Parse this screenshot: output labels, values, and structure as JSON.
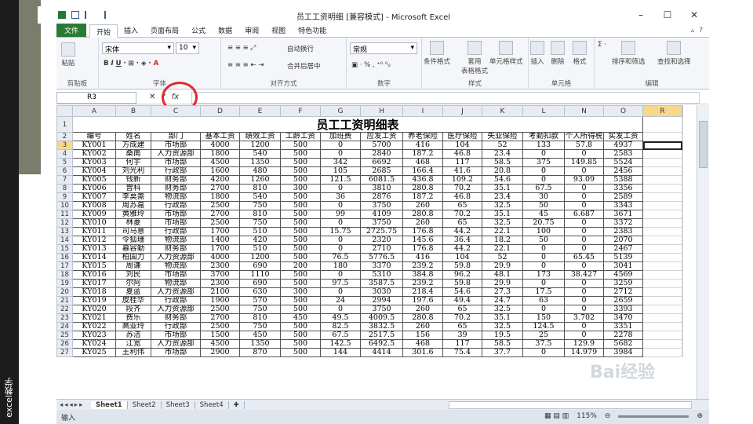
{
  "window": {
    "title": "员工工资明细 [兼容模式] - Microsoft Excel"
  },
  "side_caption": "excel教学",
  "tabs": {
    "file": "文件",
    "items": [
      "开始",
      "插入",
      "页面布局",
      "公式",
      "数据",
      "审阅",
      "视图",
      "特色功能"
    ]
  },
  "ribbon": {
    "paste": "粘贴",
    "clipboard": "剪贴板",
    "font_name": "宋体",
    "font_size": "10",
    "font_group": "字体",
    "wrap": "自动换行",
    "merge": "合并后居中",
    "align_group": "对齐方式",
    "number_format": "常规",
    "number_group": "数字",
    "cond_fmt": "条件格式",
    "table_fmt": "套用\n表格格式",
    "cell_style": "单元格样式",
    "style_group": "样式",
    "insert": "插入",
    "delete": "删除",
    "format": "格式",
    "cells_group": "单元格",
    "sort": "排序和筛选",
    "find": "查找和选择",
    "edit_group": "编辑"
  },
  "formula_bar": {
    "cell_ref": "R3",
    "formula": ""
  },
  "columns": [
    "A",
    "B",
    "C",
    "D",
    "E",
    "F",
    "G",
    "H",
    "I",
    "J",
    "K",
    "L",
    "N",
    "O",
    "R"
  ],
  "sheet": {
    "title": "员工工资明细表",
    "headers": [
      "编号",
      "姓名",
      "部门",
      "基本工资",
      "绩效工资",
      "工龄工资",
      "加班费",
      "应发工资",
      "养老保险",
      "医疗保险",
      "失业保险",
      "考勤扣款",
      "个人所得税",
      "实发工资"
    ],
    "rows": [
      [
        "KY001",
        "方成建",
        "市场部",
        "4000",
        "1200",
        "500",
        "0",
        "5700",
        "416",
        "104",
        "52",
        "133",
        "57.8",
        "4937"
      ],
      [
        "KY002",
        "桑南",
        "人力资源部",
        "1800",
        "540",
        "500",
        "0",
        "2840",
        "187.2",
        "46.8",
        "23.4",
        "0",
        "0",
        "2583"
      ],
      [
        "KY003",
        "何宇",
        "市场部",
        "4500",
        "1350",
        "500",
        "342",
        "6692",
        "468",
        "117",
        "58.5",
        "375",
        "149.85",
        "5524"
      ],
      [
        "KY004",
        "刘光利",
        "行政部",
        "1600",
        "480",
        "500",
        "105",
        "2685",
        "166.4",
        "41.6",
        "20.8",
        "0",
        "0",
        "2456"
      ],
      [
        "KY005",
        "钱新",
        "财务部",
        "4200",
        "1260",
        "500",
        "121.5",
        "6081.5",
        "436.8",
        "109.2",
        "54.6",
        "0",
        "93.09",
        "5388"
      ],
      [
        "KY006",
        "曾科",
        "财务部",
        "2700",
        "810",
        "300",
        "0",
        "3810",
        "280.8",
        "70.2",
        "35.1",
        "67.5",
        "0",
        "3356"
      ],
      [
        "KY007",
        "李莫薷",
        "物流部",
        "1800",
        "540",
        "500",
        "36",
        "2876",
        "187.2",
        "46.8",
        "23.4",
        "30",
        "0",
        "2589"
      ],
      [
        "KY008",
        "周苏嘉",
        "行政部",
        "2500",
        "750",
        "500",
        "0",
        "3750",
        "260",
        "65",
        "32.5",
        "50",
        "0",
        "3343"
      ],
      [
        "KY009",
        "黄雅玲",
        "市场部",
        "2700",
        "810",
        "500",
        "99",
        "4109",
        "280.8",
        "70.2",
        "35.1",
        "45",
        "6.687",
        "3671"
      ],
      [
        "KY010",
        "林菱",
        "市场部",
        "2500",
        "750",
        "500",
        "0",
        "3750",
        "260",
        "65",
        "32.5",
        "20.75",
        "0",
        "3372"
      ],
      [
        "KY011",
        "司马意",
        "行政部",
        "1700",
        "510",
        "500",
        "15.75",
        "2725.75",
        "176.8",
        "44.2",
        "22.1",
        "100",
        "0",
        "2383"
      ],
      [
        "KY012",
        "令狐珊",
        "物流部",
        "1400",
        "420",
        "500",
        "0",
        "2320",
        "145.6",
        "36.4",
        "18.2",
        "50",
        "0",
        "2070"
      ],
      [
        "KY013",
        "慕容勤",
        "财务部",
        "1700",
        "510",
        "500",
        "0",
        "2710",
        "176.8",
        "44.2",
        "22.1",
        "0",
        "0",
        "2467"
      ],
      [
        "KY014",
        "柏国力",
        "人力资源部",
        "4000",
        "1200",
        "500",
        "76.5",
        "5776.5",
        "416",
        "104",
        "52",
        "0",
        "65.45",
        "5139"
      ],
      [
        "KY015",
        "周谦",
        "物流部",
        "2300",
        "690",
        "200",
        "180",
        "3370",
        "239.2",
        "59.8",
        "29.9",
        "0",
        "0",
        "3041"
      ],
      [
        "KY016",
        "刘民",
        "市场部",
        "3700",
        "1110",
        "500",
        "0",
        "5310",
        "384.8",
        "96.2",
        "48.1",
        "173",
        "38.427",
        "4569"
      ],
      [
        "KY017",
        "尔阿",
        "物流部",
        "2300",
        "690",
        "500",
        "97.5",
        "3587.5",
        "239.2",
        "59.8",
        "29.9",
        "0",
        "0",
        "3259"
      ],
      [
        "KY018",
        "夏蓝",
        "人力资源部",
        "2100",
        "630",
        "300",
        "0",
        "3030",
        "218.4",
        "54.6",
        "27.3",
        "17.5",
        "0",
        "2712"
      ],
      [
        "KY019",
        "皮桂华",
        "行政部",
        "1900",
        "570",
        "500",
        "24",
        "2994",
        "197.6",
        "49.4",
        "24.7",
        "63",
        "0",
        "2659"
      ],
      [
        "KY020",
        "段齐",
        "人力资源部",
        "2500",
        "750",
        "500",
        "0",
        "3750",
        "260",
        "65",
        "32.5",
        "0",
        "0",
        "3393"
      ],
      [
        "KY021",
        "费乐",
        "财务部",
        "2700",
        "810",
        "450",
        "49.5",
        "4009.5",
        "280.8",
        "70.2",
        "35.1",
        "150",
        "3.702",
        "3470"
      ],
      [
        "KY022",
        "高亚玲",
        "行政部",
        "2500",
        "750",
        "500",
        "82.5",
        "3832.5",
        "260",
        "65",
        "32.5",
        "124.5",
        "0",
        "3351"
      ],
      [
        "KY023",
        "苏洁",
        "市场部",
        "1500",
        "450",
        "500",
        "67.5",
        "2517.5",
        "156",
        "39",
        "19.5",
        "25",
        "0",
        "2278"
      ],
      [
        "KY024",
        "江宽",
        "人力资源部",
        "4500",
        "1350",
        "500",
        "142.5",
        "6492.5",
        "468",
        "117",
        "58.5",
        "37.5",
        "129.9",
        "5682"
      ],
      [
        "KY025",
        "王利伟",
        "市场部",
        "2900",
        "870",
        "500",
        "144",
        "4414",
        "301.6",
        "75.4",
        "37.7",
        "0",
        "14.979",
        "3984"
      ]
    ]
  },
  "sheet_tabs": [
    "Sheet1",
    "Sheet2",
    "Sheet3",
    "Sheet4"
  ],
  "status": {
    "mode": "输入",
    "zoom": "115%"
  },
  "watermark": "Bai经验"
}
